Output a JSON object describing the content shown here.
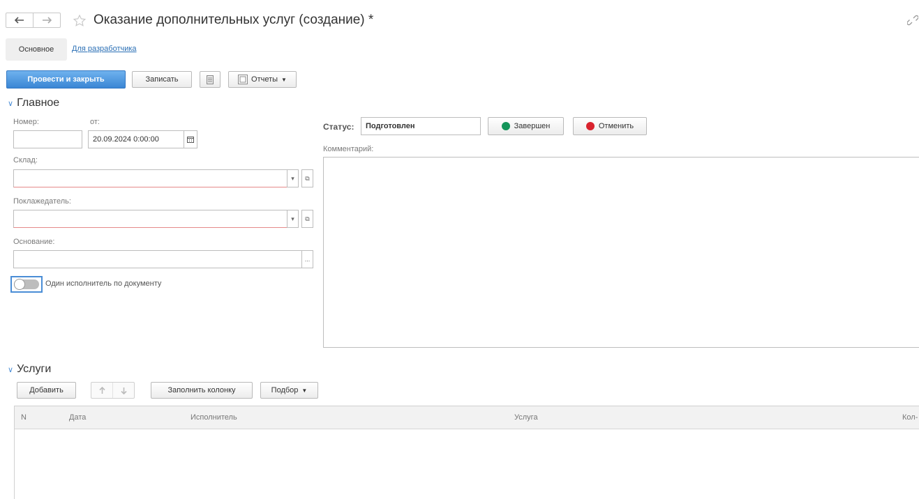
{
  "window": {
    "title": "Оказание дополнительных услуг (создание) *"
  },
  "tabs": {
    "main": "Основное",
    "developer": "Для разработчика"
  },
  "toolbar": {
    "post_close": "Провести и закрыть",
    "save": "Записать",
    "reports": "Отчеты"
  },
  "main_section": {
    "title": "Главное",
    "number_label": "Номер:",
    "number_value": "",
    "from_label": "от:",
    "date_value": "20.09.2024  0:00:00",
    "warehouse_label": "Склад:",
    "warehouse_value": "",
    "bailor_label": "Поклажедатель:",
    "bailor_value": "",
    "basis_label": "Основание:",
    "basis_value": "",
    "single_executor_label": "Один исполнитель по документу",
    "status_label": "Статус:",
    "status_value": "Подготовлен",
    "complete_label": "Завершен",
    "cancel_label": "Отменить",
    "comment_label": "Комментарий:",
    "comment_value": ""
  },
  "services_section": {
    "title": "Услуги",
    "add": "Добавить",
    "fill_column": "Заполнить колонку",
    "selection": "Подбор",
    "columns": {
      "n": "N",
      "date": "Дата",
      "executor": "Исполнитель",
      "service": "Услуга",
      "quantity": "Кол-"
    }
  },
  "colors": {
    "primary_button": "#3a86d4",
    "link": "#2a6fb5",
    "complete_dot": "#14955a",
    "cancel_dot": "#d9232e",
    "invalid_underline": "#e58a8a"
  }
}
